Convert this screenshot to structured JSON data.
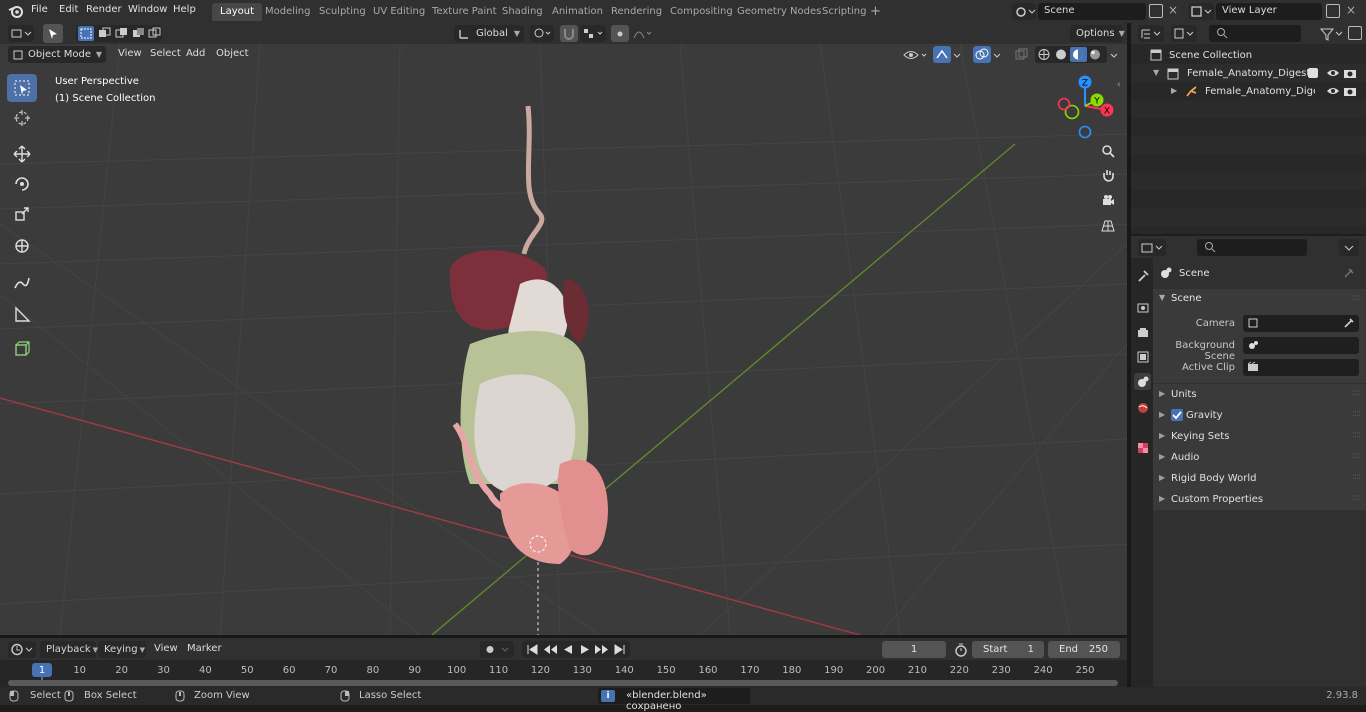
{
  "menu": [
    "File",
    "Edit",
    "Render",
    "Window",
    "Help"
  ],
  "workspaces": [
    "Layout",
    "Modeling",
    "Sculpting",
    "UV Editing",
    "Texture Paint",
    "Shading",
    "Animation",
    "Rendering",
    "Compositing",
    "Geometry Nodes",
    "Scripting"
  ],
  "active_workspace": "Layout",
  "scene_name": "Scene",
  "view_layer_name": "View Layer",
  "transform": {
    "orientation": "Global",
    "options": "Options"
  },
  "viewport_header": {
    "mode": "Object Mode",
    "items": [
      "View",
      "Select",
      "Add",
      "Object"
    ]
  },
  "viewport": {
    "title": "User Perspective",
    "subtitle": "(1) Scene Collection",
    "gizmo": {
      "x": "X",
      "y": "Y",
      "z": "Z"
    }
  },
  "outliner": {
    "root": "Scene Collection",
    "rows": [
      {
        "label": "Female_Anatomy_Digestive_"
      },
      {
        "label": "Female_Anatomy_Digest"
      }
    ]
  },
  "properties": {
    "context": "Scene",
    "panel": "Scene",
    "fields": [
      {
        "label": "Camera"
      },
      {
        "label": "Background Scene"
      },
      {
        "label": "Active Clip"
      }
    ],
    "subpanels": [
      "Units",
      "Gravity",
      "Keying Sets",
      "Audio",
      "Rigid Body World",
      "Custom Properties"
    ],
    "gravity_checked": true
  },
  "timeline": {
    "menus": [
      "Playback",
      "Keying",
      "View",
      "Marker"
    ],
    "current_frame": "1",
    "start_label": "Start",
    "start": "1",
    "end_label": "End",
    "end": "250",
    "ticks": [
      "1",
      "10",
      "20",
      "30",
      "40",
      "50",
      "60",
      "70",
      "80",
      "90",
      "100",
      "110",
      "120",
      "130",
      "140",
      "150",
      "160",
      "170",
      "180",
      "190",
      "200",
      "210",
      "220",
      "230",
      "240",
      "250"
    ]
  },
  "status": {
    "select": "Select",
    "box_select": "Box Select",
    "zoom_view": "Zoom View",
    "lasso_select": "Lasso Select",
    "message": "«blender.blend» сохранено",
    "version": "2.93.8"
  },
  "colors": {
    "accent": "#4772b3",
    "x_axis": "#ff3352",
    "y_axis": "#8bdc00",
    "z_axis": "#2890ff",
    "background": "#3b3b3b"
  }
}
